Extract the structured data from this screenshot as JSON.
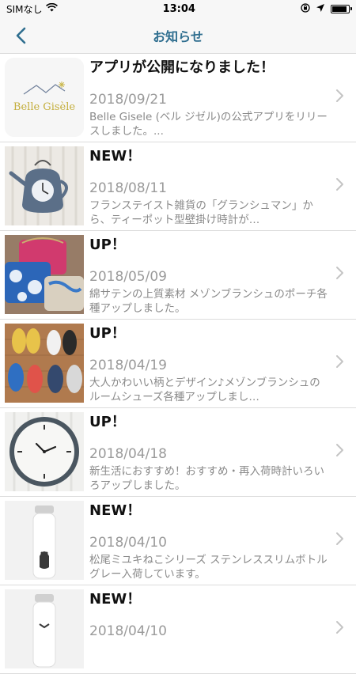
{
  "status_bar": {
    "carrier": "SIMなし",
    "time": "13:04"
  },
  "nav": {
    "title": "お知らせ",
    "back_icon": "chevron-left-icon"
  },
  "items": [
    {
      "title": "アプリが公開になりました！",
      "date": "2018/09/21",
      "desc": "Belle Gisele (ベル ジゼル)の公式アプリをリリースしました。...",
      "thumb_text": "Belle Gisèle"
    },
    {
      "title": "NEW！",
      "date": "2018/08/11",
      "desc": "フランステイスト雑貨の「グランシュマン」から、ティーポット型壁掛け時計が…"
    },
    {
      "title": "UP！",
      "date": "2018/05/09",
      "desc": "綿サテンの上質素材 メゾンブランシュのポーチ各種アップしました。"
    },
    {
      "title": "UP！",
      "date": "2018/04/19",
      "desc": "大人かわいい柄とデザイン♪メゾンブランシュのルームシューズ各種アップしまし…"
    },
    {
      "title": "UP！",
      "date": "2018/04/18",
      "desc": "新生活におすすめ！おすすめ・再入荷時計いろいろアップしました。"
    },
    {
      "title": "NEW！",
      "date": "2018/04/10",
      "desc": "松尾ミユキねこシリーズ ステンレススリムボトル グレー入荷しています。"
    },
    {
      "title": "NEW！",
      "date": "2018/04/10",
      "desc": ""
    }
  ]
}
